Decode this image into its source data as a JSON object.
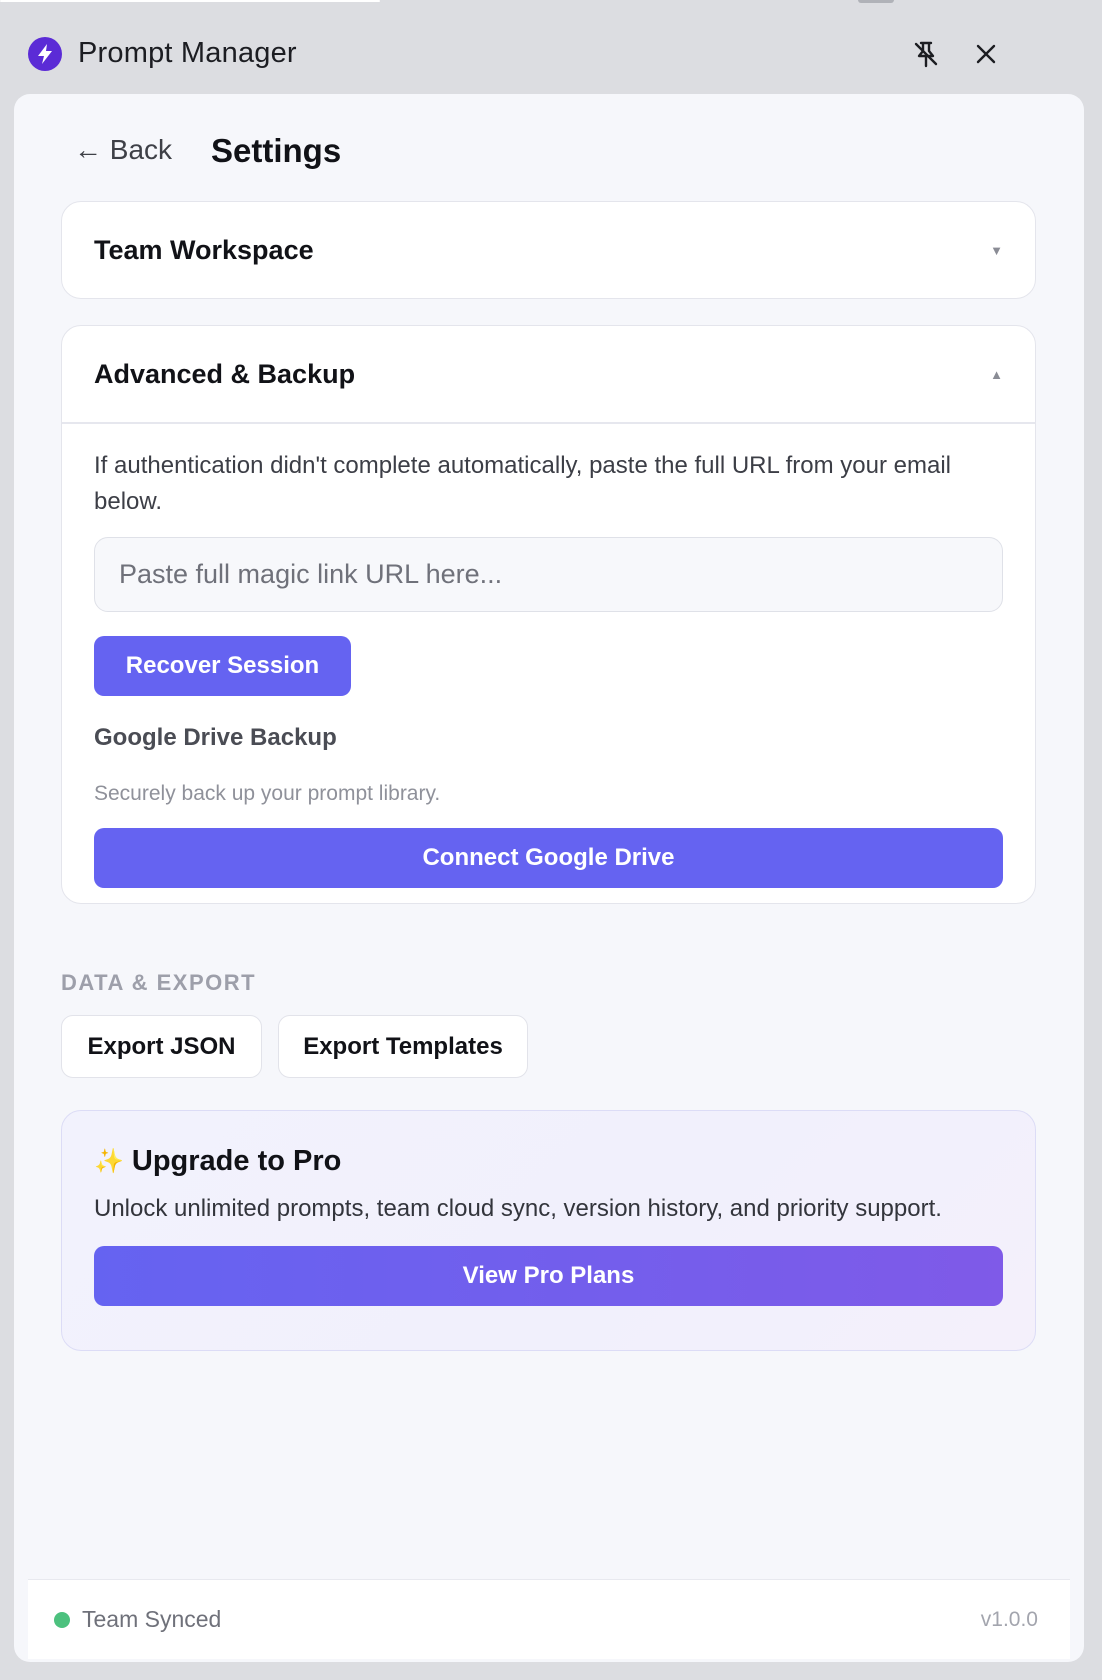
{
  "window": {
    "title": "Prompt Manager",
    "app_icon": "lightning-bolt-icon",
    "unpin_icon": "unpin-icon",
    "close_icon": "close-icon"
  },
  "header": {
    "back_label": "← Back",
    "title": "Settings"
  },
  "team_workspace": {
    "title": "Team Workspace",
    "caret": "▼",
    "expanded": false
  },
  "advanced_backup": {
    "title": "Advanced & Backup",
    "caret": "▲",
    "expanded": true,
    "help_text": "If authentication didn't complete automatically, paste the full URL from your email below.",
    "url_input": {
      "value": "",
      "placeholder": "Paste full magic link URL here..."
    },
    "recover_button": "Recover Session",
    "gdrive_title": "Google Drive Backup",
    "gdrive_desc": "Securely back up your prompt library.",
    "gdrive_button": "Connect Google Drive"
  },
  "data_export": {
    "label": "DATA & EXPORT",
    "export_json": "Export JSON",
    "export_templates": "Export Templates"
  },
  "pro": {
    "sparkle": "✨",
    "title": "Upgrade to Pro",
    "description": "Unlock unlimited prompts, team cloud sync, version history, and priority support.",
    "button": "View Pro Plans"
  },
  "footer": {
    "status": "Team Synced",
    "status_color": "#4cc17e",
    "version": "v1.0.0"
  },
  "colors": {
    "accent": "#6563f1",
    "accent_gradient_end": "#7f5ae8",
    "app_icon": "#5b2bd6"
  }
}
